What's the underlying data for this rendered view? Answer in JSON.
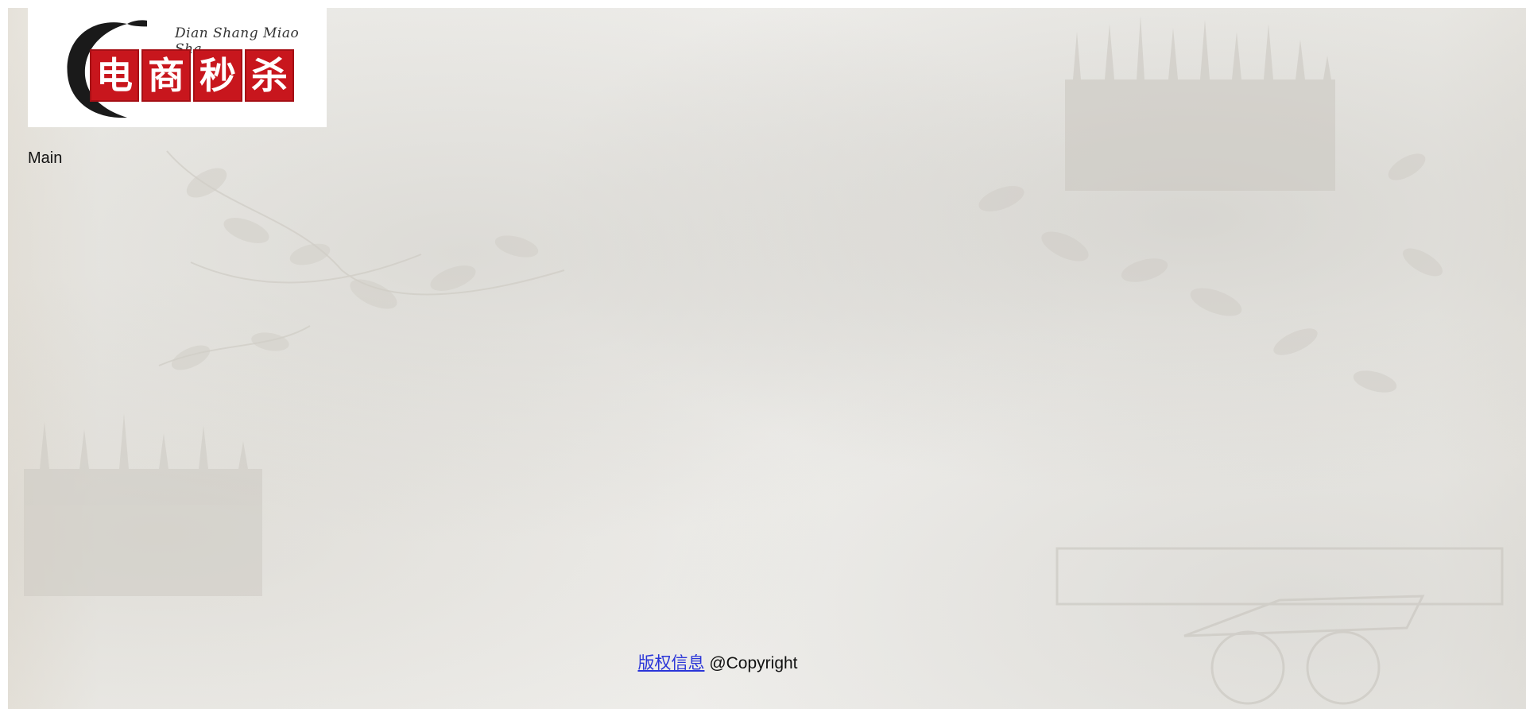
{
  "logo": {
    "subtitle": "Dian Shang Miao Sha",
    "chars": [
      "电",
      "商",
      "秒",
      "杀"
    ]
  },
  "main": {
    "label": "Main"
  },
  "footer": {
    "link_text": "版权信息",
    "copyright_text": "@Copyright"
  },
  "colors": {
    "logo_red": "#c8161d",
    "link_blue": "#2a35d8",
    "background": "#ecebe7"
  }
}
